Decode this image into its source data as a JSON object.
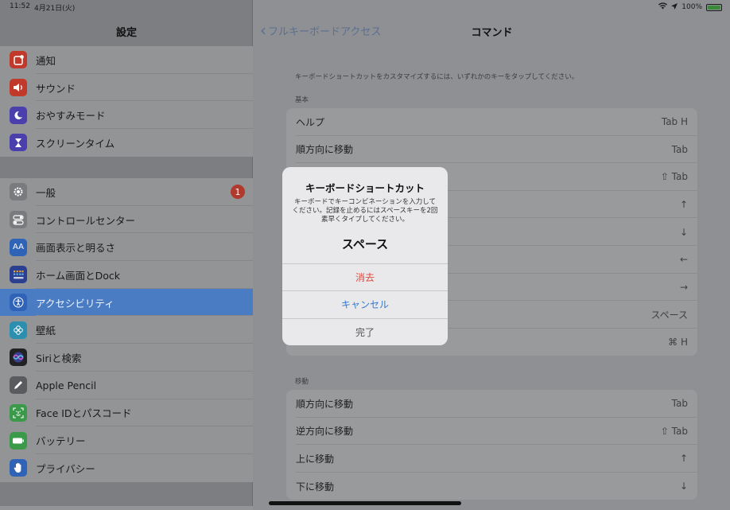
{
  "status": {
    "time": "11:52",
    "date": "4月21日(火)",
    "battery": "100%"
  },
  "sidebar": {
    "title": "設定",
    "group1": [
      {
        "label": "通知",
        "icon": "notifications-icon",
        "color": "#c0392b"
      },
      {
        "label": "サウンド",
        "icon": "sound-icon",
        "color": "#c0392b"
      },
      {
        "label": "おやすみモード",
        "icon": "moon-icon",
        "color": "#4b3fae"
      },
      {
        "label": "スクリーンタイム",
        "icon": "hourglass-icon",
        "color": "#4b3fae"
      }
    ],
    "group2": [
      {
        "label": "一般",
        "icon": "gear-icon",
        "color": "#7a7b7e",
        "badge": "1"
      },
      {
        "label": "コントロールセンター",
        "icon": "toggles-icon",
        "color": "#7a7b7e"
      },
      {
        "label": "画面表示と明るさ",
        "icon": "text-size-icon",
        "color": "#2f63b8",
        "glyph": "AA"
      },
      {
        "label": "ホーム画面とDock",
        "icon": "home-grid-icon",
        "color": "#2a3f8f"
      },
      {
        "label": "アクセシビリティ",
        "icon": "accessibility-icon",
        "color": "#2f63b8",
        "active": true
      },
      {
        "label": "壁紙",
        "icon": "flower-icon",
        "color": "#2b8fb0"
      },
      {
        "label": "Siriと検索",
        "icon": "siri-icon",
        "color": "#222"
      },
      {
        "label": "Apple Pencil",
        "icon": "pencil-icon",
        "color": "#5a5b5e"
      },
      {
        "label": "Face IDとパスコード",
        "icon": "face-id-icon",
        "color": "#3a9a4a"
      },
      {
        "label": "バッテリー",
        "icon": "battery-icon",
        "color": "#3a9a4a"
      },
      {
        "label": "プライバシー",
        "icon": "hand-icon",
        "color": "#2f63b8"
      }
    ]
  },
  "main": {
    "back_label": "フルキーボードアクセス",
    "title": "コマンド",
    "hint": "キーボードショートカットをカスタマイズするには、いずれかのキーをタップしてください。",
    "section_basic": "基本",
    "basic_rows": [
      {
        "label": "ヘルプ",
        "value": "Tab H"
      },
      {
        "label": "順方向に移動",
        "value": "Tab"
      },
      {
        "label": "",
        "value": "⇧ Tab"
      },
      {
        "label": "",
        "value": "↑"
      },
      {
        "label": "",
        "value": "↓"
      },
      {
        "label": "",
        "value": "←"
      },
      {
        "label": "",
        "value": "→"
      },
      {
        "label": "",
        "value": "スペース"
      },
      {
        "label": "",
        "value": "⌘ H"
      }
    ],
    "section_move": "移動",
    "move_rows": [
      {
        "label": "順方向に移動",
        "value": "Tab"
      },
      {
        "label": "逆方向に移動",
        "value": "⇧ Tab"
      },
      {
        "label": "上に移動",
        "value": "↑"
      },
      {
        "label": "下に移動",
        "value": "↓"
      }
    ]
  },
  "alert": {
    "title": "キーボードショートカット",
    "message": "キーボードでキーコンビネーションを入力してください。記録を止めるにはスペースキーを2回素早くタイプしてください。",
    "key": "スペース",
    "delete_label": "消去",
    "cancel_label": "キャンセル",
    "done_label": "完了"
  }
}
